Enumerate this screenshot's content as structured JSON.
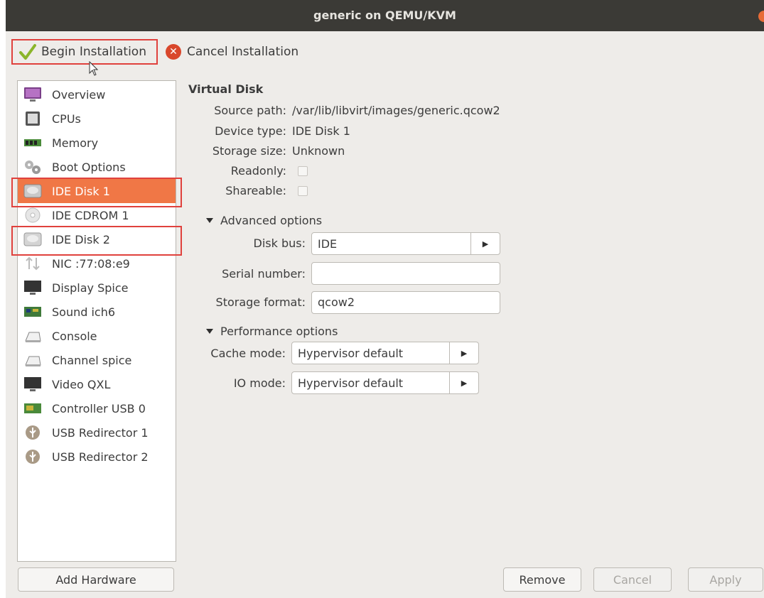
{
  "window": {
    "title": "generic on QEMU/KVM"
  },
  "toolbar": {
    "begin_label": "Begin Installation",
    "cancel_label": "Cancel Installation"
  },
  "sidebar": {
    "items": [
      {
        "label": "Overview",
        "icon": "monitor-icon"
      },
      {
        "label": "CPUs",
        "icon": "cpu-icon"
      },
      {
        "label": "Memory",
        "icon": "memory-icon"
      },
      {
        "label": "Boot Options",
        "icon": "gears-icon"
      },
      {
        "label": "IDE Disk 1",
        "icon": "hard-disk-icon"
      },
      {
        "label": "IDE CDROM 1",
        "icon": "cdrom-icon"
      },
      {
        "label": "IDE Disk 2",
        "icon": "hard-disk-icon"
      },
      {
        "label": "NIC :77:08:e9",
        "icon": "network-icon"
      },
      {
        "label": "Display Spice",
        "icon": "display-icon"
      },
      {
        "label": "Sound ich6",
        "icon": "sound-card-icon"
      },
      {
        "label": "Console",
        "icon": "serial-console-icon"
      },
      {
        "label": "Channel spice",
        "icon": "serial-console-icon"
      },
      {
        "label": "Video QXL",
        "icon": "display-icon"
      },
      {
        "label": "Controller USB 0",
        "icon": "pci-card-icon"
      },
      {
        "label": "USB Redirector 1",
        "icon": "usb-icon"
      },
      {
        "label": "USB Redirector 2",
        "icon": "usb-icon"
      }
    ],
    "selected": "IDE Disk 1"
  },
  "disk": {
    "section_title": "Virtual Disk",
    "source_path_label": "Source path:",
    "source_path": "/var/lib/libvirt/images/generic.qcow2",
    "device_type_label": "Device type:",
    "device_type": "IDE Disk 1",
    "storage_size_label": "Storage size:",
    "storage_size": "Unknown",
    "readonly_label": "Readonly:",
    "shareable_label": "Shareable:"
  },
  "advanced": {
    "title": "Advanced options",
    "disk_bus_label": "Disk bus:",
    "disk_bus": "IDE",
    "serial_label": "Serial number:",
    "serial_value": "",
    "format_label": "Storage format:",
    "format_value": "qcow2"
  },
  "performance": {
    "title": "Performance options",
    "cache_label": "Cache mode:",
    "cache_value": "Hypervisor default",
    "io_label": "IO mode:",
    "io_value": "Hypervisor default"
  },
  "buttons": {
    "add_hardware": "Add Hardware",
    "remove": "Remove",
    "cancel": "Cancel",
    "apply": "Apply"
  },
  "colors": {
    "selection": "#f07746",
    "highlight_box": "#e0413d",
    "titlebar": "#3b3a36"
  }
}
